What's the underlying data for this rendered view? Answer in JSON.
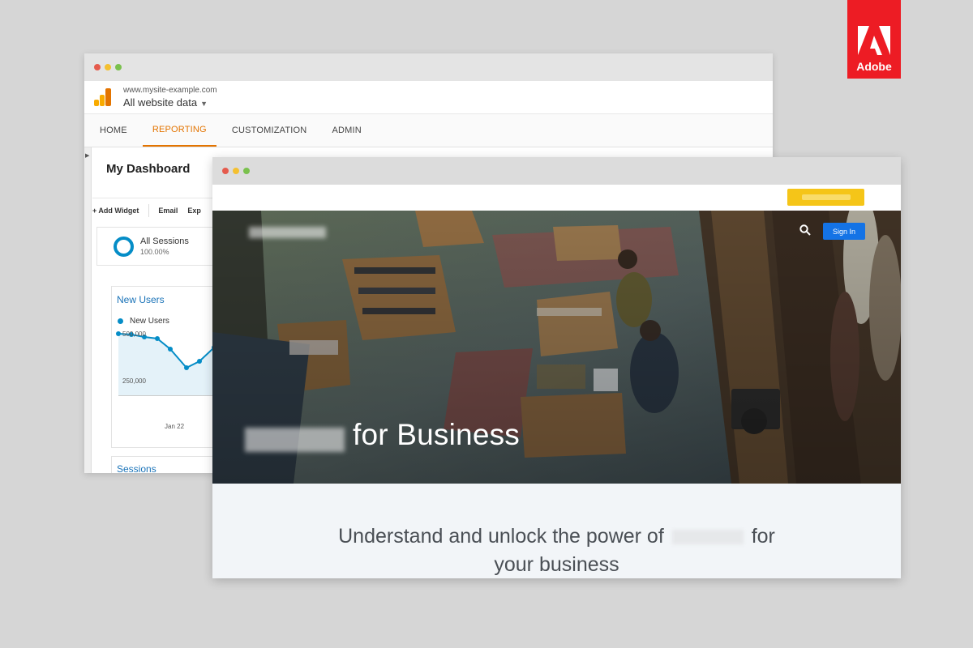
{
  "brand_badge": {
    "wordmark": "Adobe",
    "color": "#ed1c24"
  },
  "back_window": {
    "site_url": "www.mysite-example.com",
    "property_select": "All website data",
    "nav": [
      {
        "label": "HOME",
        "active": false
      },
      {
        "label": "REPORTING",
        "active": true
      },
      {
        "label": "CUSTOMIZATION",
        "active": false
      },
      {
        "label": "ADMIN",
        "active": false
      }
    ],
    "dashboard_title": "My Dashboard",
    "toolbar": {
      "add_widget": "+ Add Widget",
      "email": "Email",
      "export": "Exp"
    },
    "sessions_widget": {
      "label": "All Sessions",
      "percent": "100.00%"
    },
    "new_users_widget": {
      "title": "New Users",
      "legend": "New Users",
      "y_ticks": [
        "500,000",
        "250,000"
      ],
      "x_tick": "Jan 22"
    },
    "sessions_widget_2": {
      "title": "Sessions"
    },
    "accent_color": "#e37400",
    "chart_color": "#058dc7"
  },
  "front_window": {
    "hero_title": "for Business",
    "sign_in": "Sign In",
    "tagline_line1_start": "Understand and unlock the power of",
    "tagline_line1_end": "for",
    "tagline_line2": "your business",
    "primary_color": "#1473e6",
    "cta_color": "#f5c518"
  }
}
